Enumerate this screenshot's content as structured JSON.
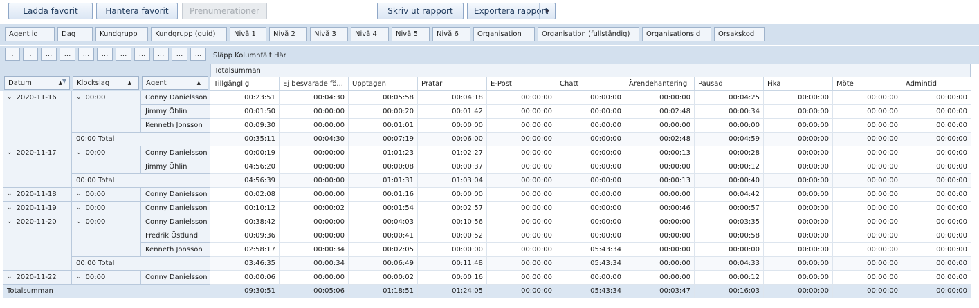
{
  "toolbar": {
    "load_favorite": "Ladda favorit",
    "manage_favorite": "Hantera favorit",
    "subscriptions": "Prenumerationer",
    "print_report": "Skriv ut rapport",
    "export_report": "Exportera rapport"
  },
  "filter_fields": [
    "Agent id",
    "Dag",
    "Kundgrupp",
    "Kundgrupp (guid)",
    "Nivå 1",
    "Nivå 2",
    "Nivå 3",
    "Nivå 4",
    "Nivå 5",
    "Nivå 6",
    "Organisation",
    "Organisation (fullständig)",
    "Organisationsid",
    "Orsakskod"
  ],
  "collapsed_fields": [
    ".",
    ".",
    "...",
    "...",
    "...",
    "...",
    "...",
    "...",
    "...",
    "...",
    "..."
  ],
  "drop_zone": "Släpp Kolumnfält Här",
  "row_headers": {
    "date": "Datum",
    "time": "Klockslag",
    "agent": "Agent"
  },
  "grand_total_label": "Totalsumman",
  "column_group": "Totalsumman",
  "columns": [
    "Tillgänglig",
    "Ej besvarade fö...",
    "Upptagen",
    "Pratar",
    "E-Post",
    "Chatt",
    "Ärendehantering",
    "Pausad",
    "Fika",
    "Möte",
    "Admintid"
  ],
  "colors": {
    "accent": "#d3e0ee",
    "header_bg": "#eef3f9",
    "grand_total_bg": "#dbe6f2"
  },
  "groups": [
    {
      "date": "2020-11-16",
      "time": "00:00",
      "total_label": "00:00 Total",
      "rows": [
        {
          "agent": "Conny Danielsson",
          "v": [
            "00:23:51",
            "00:04:30",
            "00:05:58",
            "00:04:18",
            "00:00:00",
            "00:00:00",
            "00:00:00",
            "00:04:25",
            "00:00:00",
            "00:00:00",
            "00:00:00"
          ]
        },
        {
          "agent": "Jimmy Öhlin",
          "v": [
            "00:01:50",
            "00:00:00",
            "00:00:20",
            "00:01:42",
            "00:00:00",
            "00:00:00",
            "00:02:48",
            "00:00:34",
            "00:00:00",
            "00:00:00",
            "00:00:00"
          ]
        },
        {
          "agent": "Kenneth Jonsson",
          "v": [
            "00:09:30",
            "00:00:00",
            "00:01:01",
            "00:00:00",
            "00:00:00",
            "00:00:00",
            "00:00:00",
            "00:00:00",
            "00:00:00",
            "00:00:00",
            "00:00:00"
          ]
        }
      ],
      "total": [
        "00:35:11",
        "00:04:30",
        "00:07:19",
        "00:06:00",
        "00:00:00",
        "00:00:00",
        "00:02:48",
        "00:04:59",
        "00:00:00",
        "00:00:00",
        "00:00:00"
      ]
    },
    {
      "date": "2020-11-17",
      "time": "00:00",
      "total_label": "00:00 Total",
      "rows": [
        {
          "agent": "Conny Danielsson",
          "v": [
            "00:00:19",
            "00:00:00",
            "01:01:23",
            "01:02:27",
            "00:00:00",
            "00:00:00",
            "00:00:13",
            "00:00:28",
            "00:00:00",
            "00:00:00",
            "00:00:00"
          ]
        },
        {
          "agent": "Jimmy Öhlin",
          "v": [
            "04:56:20",
            "00:00:00",
            "00:00:08",
            "00:00:37",
            "00:00:00",
            "00:00:00",
            "00:00:00",
            "00:00:12",
            "00:00:00",
            "00:00:00",
            "00:00:00"
          ]
        }
      ],
      "total": [
        "04:56:39",
        "00:00:00",
        "01:01:31",
        "01:03:04",
        "00:00:00",
        "00:00:00",
        "00:00:13",
        "00:00:40",
        "00:00:00",
        "00:00:00",
        "00:00:00"
      ]
    },
    {
      "date": "2020-11-18",
      "time": "00:00",
      "rows": [
        {
          "agent": "Conny Danielsson",
          "v": [
            "00:02:08",
            "00:00:00",
            "00:01:16",
            "00:00:00",
            "00:00:00",
            "00:00:00",
            "00:00:00",
            "00:04:42",
            "00:00:00",
            "00:00:00",
            "00:00:00"
          ]
        }
      ]
    },
    {
      "date": "2020-11-19",
      "time": "00:00",
      "rows": [
        {
          "agent": "Conny Danielsson",
          "v": [
            "00:10:12",
            "00:00:02",
            "00:01:54",
            "00:02:57",
            "00:00:00",
            "00:00:00",
            "00:00:46",
            "00:00:57",
            "00:00:00",
            "00:00:00",
            "00:00:00"
          ]
        }
      ]
    },
    {
      "date": "2020-11-20",
      "time": "00:00",
      "total_label": "00:00 Total",
      "rows": [
        {
          "agent": "Conny Danielsson",
          "v": [
            "00:38:42",
            "00:00:00",
            "00:04:03",
            "00:10:56",
            "00:00:00",
            "00:00:00",
            "00:00:00",
            "00:03:35",
            "00:00:00",
            "00:00:00",
            "00:00:00"
          ]
        },
        {
          "agent": "Fredrik Östlund",
          "v": [
            "00:09:36",
            "00:00:00",
            "00:00:41",
            "00:00:52",
            "00:00:00",
            "00:00:00",
            "00:00:00",
            "00:00:58",
            "00:00:00",
            "00:00:00",
            "00:00:00"
          ]
        },
        {
          "agent": "Kenneth Jonsson",
          "v": [
            "02:58:17",
            "00:00:34",
            "00:02:05",
            "00:00:00",
            "00:00:00",
            "05:43:34",
            "00:00:00",
            "00:00:00",
            "00:00:00",
            "00:00:00",
            "00:00:00"
          ]
        }
      ],
      "total": [
        "03:46:35",
        "00:00:34",
        "00:06:49",
        "00:11:48",
        "00:00:00",
        "05:43:34",
        "00:00:00",
        "00:04:33",
        "00:00:00",
        "00:00:00",
        "00:00:00"
      ]
    },
    {
      "date": "2020-11-22",
      "time": "00:00",
      "rows": [
        {
          "agent": "Conny Danielsson",
          "v": [
            "00:00:06",
            "00:00:00",
            "00:00:02",
            "00:00:16",
            "00:00:00",
            "00:00:00",
            "00:00:00",
            "00:00:12",
            "00:00:00",
            "00:00:00",
            "00:00:00"
          ]
        }
      ]
    }
  ],
  "grand_total": [
    "09:30:51",
    "00:05:06",
    "01:18:51",
    "01:24:05",
    "00:00:00",
    "05:43:34",
    "00:03:47",
    "00:16:03",
    "00:00:00",
    "00:00:00",
    "00:00:00"
  ]
}
